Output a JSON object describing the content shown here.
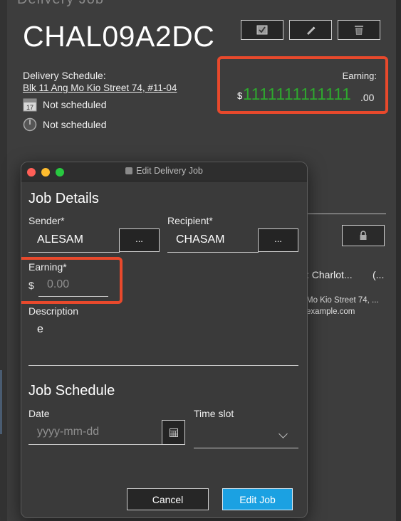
{
  "header": {
    "partial_title": "Delivery Job",
    "job_id": "CHAL09A2DC",
    "toolbar": [
      {
        "name": "checkbox-button",
        "icon": "check-icon"
      },
      {
        "name": "edit-button",
        "icon": "pencil-icon"
      },
      {
        "name": "delete-button",
        "icon": "trash-icon"
      }
    ]
  },
  "schedule": {
    "label": "Delivery Schedule:",
    "address": "Blk 11 Ang Mo Kio Street 74, #11-04",
    "date_text": "Not scheduled",
    "date_icon_day": "17",
    "time_text": "Not scheduled"
  },
  "earning": {
    "label": "Earning:",
    "currency": "$",
    "integer": "1111111111111",
    "decimal": ".00",
    "color": "#2ea82e"
  },
  "background_contact": {
    "name_prefix": ":  Charlot...",
    "name_extra": "(...",
    "address": "Mo Kio Street 74, ...",
    "email": "example.com"
  },
  "dialog": {
    "title": "Edit Delivery Job",
    "job_details": {
      "heading": "Job Details",
      "sender_label": "Sender*",
      "sender_value": "ALESAM",
      "recipient_label": "Recipient*",
      "recipient_value": "CHASAM",
      "picker_label": "...",
      "earning_label": "Earning*",
      "earning_currency": "$",
      "earning_placeholder": "0.00",
      "description_label": "Description",
      "description_value": "e"
    },
    "job_schedule": {
      "heading": "Job Schedule",
      "date_label": "Date",
      "date_placeholder": "yyyy-mm-dd",
      "timeslot_label": "Time slot",
      "timeslot_value": ""
    },
    "buttons": {
      "cancel": "Cancel",
      "edit": "Edit Job"
    }
  },
  "colors": {
    "highlight": "#e8492c",
    "accent_button": "#1ba1e2",
    "traffic_close": "#ff5f57",
    "traffic_min": "#febc2e",
    "traffic_max": "#28c840"
  }
}
